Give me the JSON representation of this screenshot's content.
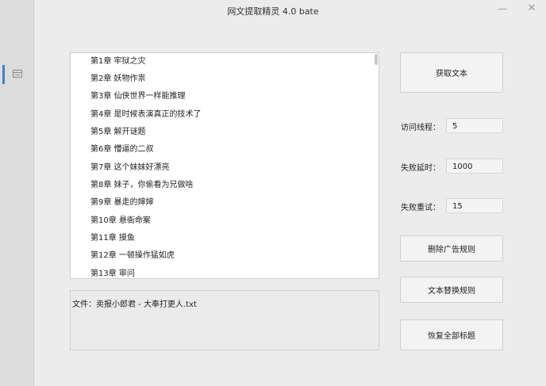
{
  "window": {
    "title": "网文提取精灵 4.0 bate",
    "minimize_glyph": "—",
    "close_glyph": "✕"
  },
  "sidebar": {
    "items": [
      {
        "icon": "list-window-icon",
        "active": true
      }
    ],
    "accent_color": "#3b82d6"
  },
  "chapters": [
    "第1章 牢狱之灾",
    "第2章 妖物作祟",
    "第3章 仙侠世界一样能推理",
    "第4章 是时候表演真正的技术了",
    "第5章 解开谜题",
    "第6章 懵逼的二叔",
    "第7章 这个妹妹好漂亮",
    "第8章 妹子，你偷看为兄做啥",
    "第9章 暴走的婶婶",
    "第10章 悬衙命案",
    "第11章 摸鱼",
    "第12章 一顿操作猛如虎",
    "第13章 审问"
  ],
  "file_info": {
    "label": "文件：卖报小郎君 - 大奉打更人.txt"
  },
  "buttons": {
    "fetch": "获取文本",
    "delete_ad_rules": "删除广告规则",
    "text_replace_rules": "文本替换规则",
    "restore_titles": "恢复全部标题"
  },
  "settings": {
    "threads_label": "访问线程：",
    "threads_value": "5",
    "retry_delay_label": "失败延时：",
    "retry_delay_value": "1000",
    "retry_count_label": "失败重试：",
    "retry_count_value": "15"
  }
}
